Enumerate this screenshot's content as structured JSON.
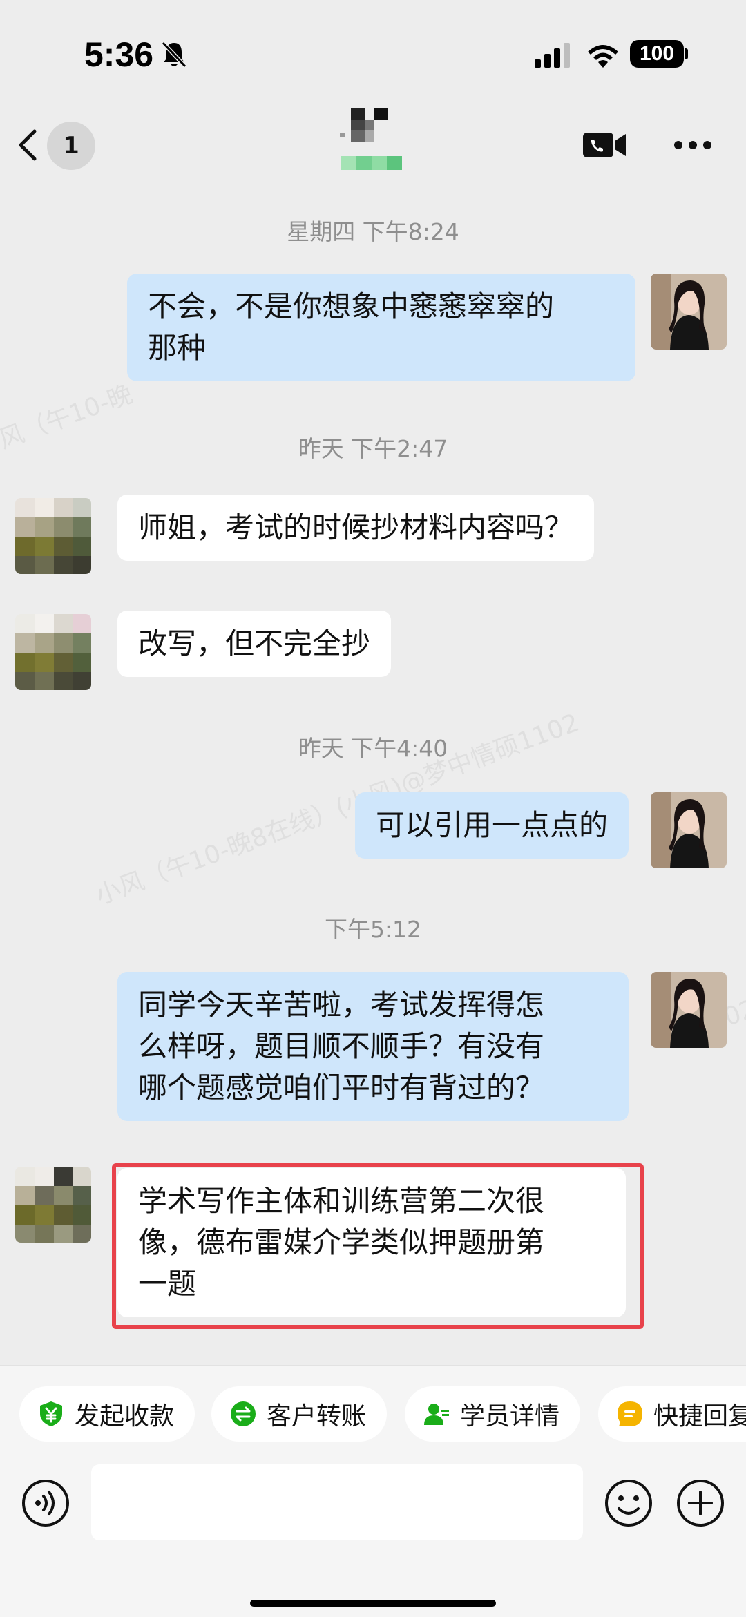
{
  "status_bar": {
    "time": "5:36",
    "battery": "100",
    "icons": [
      "bell-off-icon",
      "signal-icon",
      "wifi-icon",
      "battery-icon"
    ]
  },
  "nav": {
    "unread_count": "1",
    "icons": [
      "back-icon",
      "video-call-icon",
      "more-icon"
    ]
  },
  "watermark": {
    "lines": [
      "小风（午10-晚8在线）(小风)@梦中情硕1102",
      "风（午10-晚",
      "1102"
    ]
  },
  "messages": [
    {
      "type": "timestamp",
      "text": "星期四 下午8:24"
    },
    {
      "type": "message",
      "sender": "me",
      "lines": [
        "不会，不是你想象中窸窸窣窣的",
        "那种"
      ]
    },
    {
      "type": "timestamp",
      "text": "昨天 下午2:47"
    },
    {
      "type": "message",
      "sender": "them",
      "lines": [
        "师姐，考试的时候抄材料内容吗？"
      ]
    },
    {
      "type": "message",
      "sender": "them",
      "lines": [
        "改写，但不完全抄"
      ]
    },
    {
      "type": "timestamp",
      "text": "昨天 下午4:40"
    },
    {
      "type": "message",
      "sender": "me",
      "lines": [
        "可以引用一点点的"
      ]
    },
    {
      "type": "timestamp",
      "text": "下午5:12"
    },
    {
      "type": "message",
      "sender": "me",
      "lines": [
        "同学今天辛苦啦，考试发挥得怎",
        "么样呀，题目顺不顺手？有没有",
        "哪个题感觉咱们平时有背过的？"
      ]
    },
    {
      "type": "message",
      "sender": "them",
      "highlighted": true,
      "lines": [
        "学术写作主体和训练营第二次很",
        "像，德布雷媒介学类似押题册第",
        "一题"
      ]
    }
  ],
  "quick_actions": [
    {
      "label": "发起收款",
      "icon": "payment-request-icon",
      "color": "#1aad19"
    },
    {
      "label": "客户转账",
      "icon": "transfer-icon",
      "color": "#1aad19"
    },
    {
      "label": "学员详情",
      "icon": "student-details-icon",
      "color": "#1aad19"
    },
    {
      "label": "快捷回复",
      "icon": "quick-reply-icon",
      "color": "#f5b400"
    }
  ],
  "input": {
    "placeholder": "",
    "icons": [
      "voice-icon",
      "emoji-icon",
      "plus-icon"
    ]
  },
  "colors": {
    "my_bubble": "#cfe6fb",
    "their_bubble": "#ffffff",
    "highlight_border": "#e8424b",
    "background": "#ededed"
  }
}
